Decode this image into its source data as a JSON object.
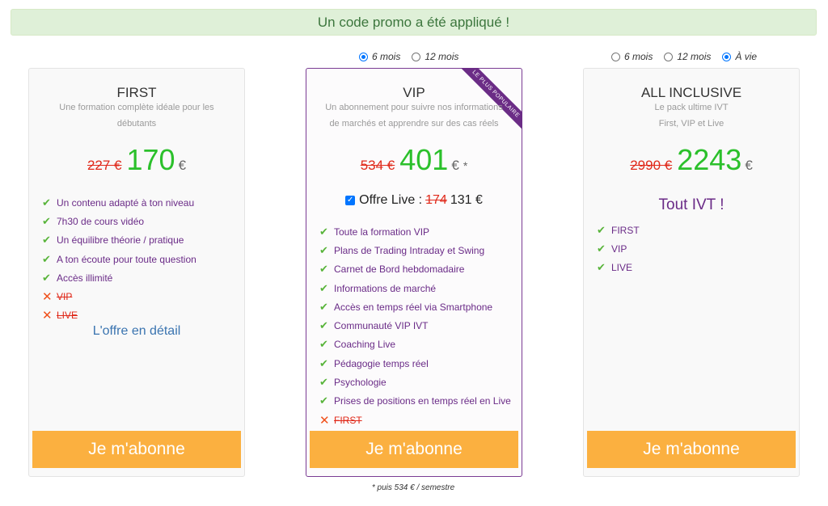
{
  "banner": {
    "text": "Un code promo a été appliqué !"
  },
  "plans": {
    "first": {
      "title": "FIRST",
      "subtitle_line1": "Une formation complète idéale pour les",
      "subtitle_line2": "débutants",
      "old_price": "227 €",
      "new_price": "170",
      "currency": "€",
      "features": [
        {
          "text": "Un contenu adapté à ton niveau"
        },
        {
          "text": "7h30 de cours vidéo"
        },
        {
          "text": "Un équilibre théorie / pratique"
        },
        {
          "text": "A ton écoute pour toute question"
        },
        {
          "text": "Accès illimité"
        }
      ],
      "excluded": [
        {
          "text": "VIP"
        },
        {
          "text": "LIVE"
        }
      ],
      "detail_link": "L'offre en détail",
      "cta": "Je m'abonne"
    },
    "vip": {
      "durations": [
        {
          "label": "6 mois",
          "selected": true
        },
        {
          "label": "12 mois",
          "selected": false
        }
      ],
      "ribbon": "LE PLUS POPULAIRE",
      "title": "VIP",
      "subtitle_line1": "Un abonnement pour suivre nos informations",
      "subtitle_line2": "de marchés et apprendre sur des cas réels",
      "old_price": "534 €",
      "new_price": "401",
      "currency": "€",
      "star": "*",
      "live_option": {
        "label": "Offre Live :",
        "old": "174",
        "new": "131 €",
        "checked": true
      },
      "features": [
        {
          "text": "Toute la formation VIP"
        },
        {
          "text": "Plans de Trading Intraday et Swing"
        },
        {
          "text": "Carnet de Bord hebdomadaire"
        },
        {
          "text": "Informations de marché"
        },
        {
          "text": "Accès en temps réel via Smartphone"
        },
        {
          "text": "Communauté VIP IVT"
        },
        {
          "text": "Coaching Live"
        },
        {
          "text": "Pédagogie temps réel"
        },
        {
          "text": "Psychologie"
        },
        {
          "text": "Prises de positions en temps réel en Live"
        }
      ],
      "excluded": [
        {
          "text": "FIRST"
        }
      ],
      "cta": "Je m'abonne",
      "footnote": "* puis 534 € / semestre"
    },
    "all": {
      "durations": [
        {
          "label": "6 mois",
          "selected": false
        },
        {
          "label": "12 mois",
          "selected": false
        },
        {
          "label": "À vie",
          "selected": true
        }
      ],
      "title": "ALL INCLUSIVE",
      "subtitle_line1": "Le pack ultime IVT",
      "subtitle_line2": "First, VIP et Live",
      "old_price": "2990 €",
      "new_price": "2243",
      "currency": "€",
      "headline": "Tout IVT !",
      "features": [
        {
          "text": "FIRST"
        },
        {
          "text": "VIP"
        },
        {
          "text": "LIVE"
        }
      ],
      "cta": "Je m'abonne"
    }
  },
  "icons": {
    "check": "check-icon",
    "cross": "cross-icon"
  },
  "colors": {
    "accent": "#6b2c86",
    "cta": "#fbb040",
    "price_new": "#2bc02b",
    "price_old": "#e0291a"
  }
}
